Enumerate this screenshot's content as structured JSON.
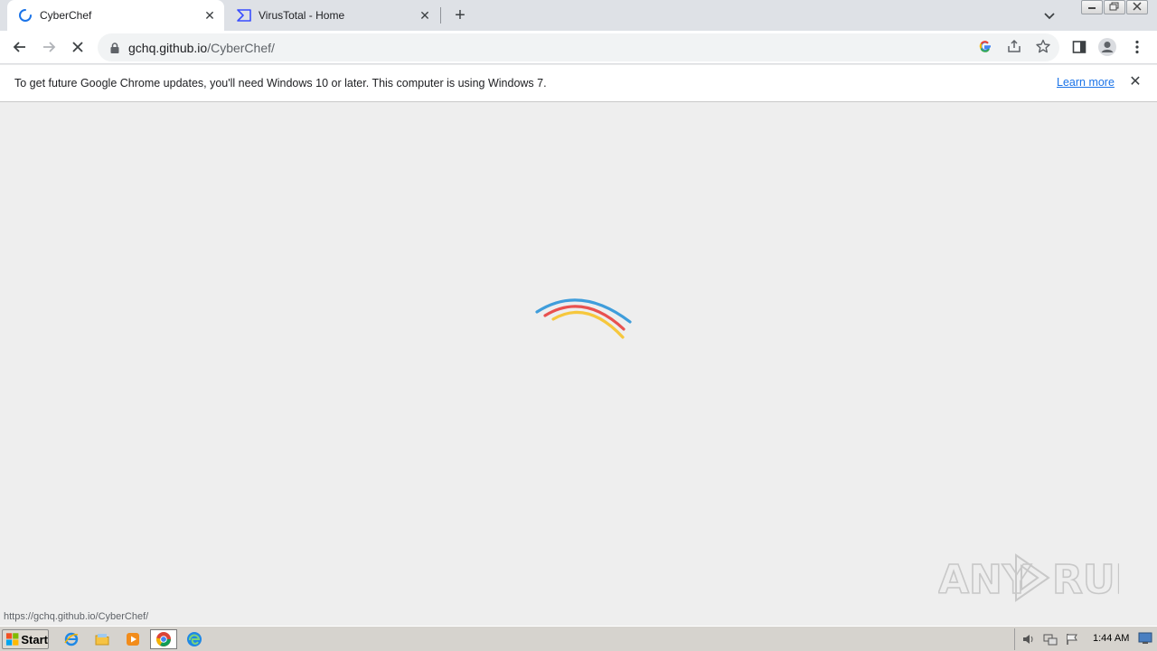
{
  "browser": {
    "tabs": [
      {
        "title": "CyberChef",
        "icon": "loading-spinner-icon",
        "active": true
      },
      {
        "title": "VirusTotal - Home",
        "icon": "virustotal-icon",
        "active": false
      }
    ],
    "new_tab_label": "+",
    "tab_close_glyph": "✕",
    "url_host": "gchq.github.io",
    "url_path": "/CyberChef/",
    "icons": {
      "back": "back-arrow-icon",
      "forward": "forward-arrow-icon",
      "stop": "stop-loading-icon",
      "lock": "lock-icon",
      "google_lens": "google-icon",
      "share": "share-icon",
      "bookmark": "star-icon",
      "side_panel": "side-panel-icon",
      "profile": "profile-icon",
      "menu": "kebab-menu-icon"
    }
  },
  "infobar": {
    "message": "To get future Google Chrome updates, you'll need Windows 10 or later. This computer is using Windows 7.",
    "link_label": "Learn more",
    "close_glyph": "✕"
  },
  "page": {
    "status_url": "https://gchq.github.io/CyberChef/",
    "loader_colors": [
      "#3f9ddb",
      "#e8514f",
      "#f6c73c"
    ],
    "watermark": "ANY RUN"
  },
  "taskbar": {
    "start_label": "Start",
    "apps": [
      "internet-explorer-icon",
      "file-explorer-icon",
      "media-player-icon",
      "chrome-icon",
      "edge-icon"
    ],
    "clock": "1:44 AM"
  }
}
